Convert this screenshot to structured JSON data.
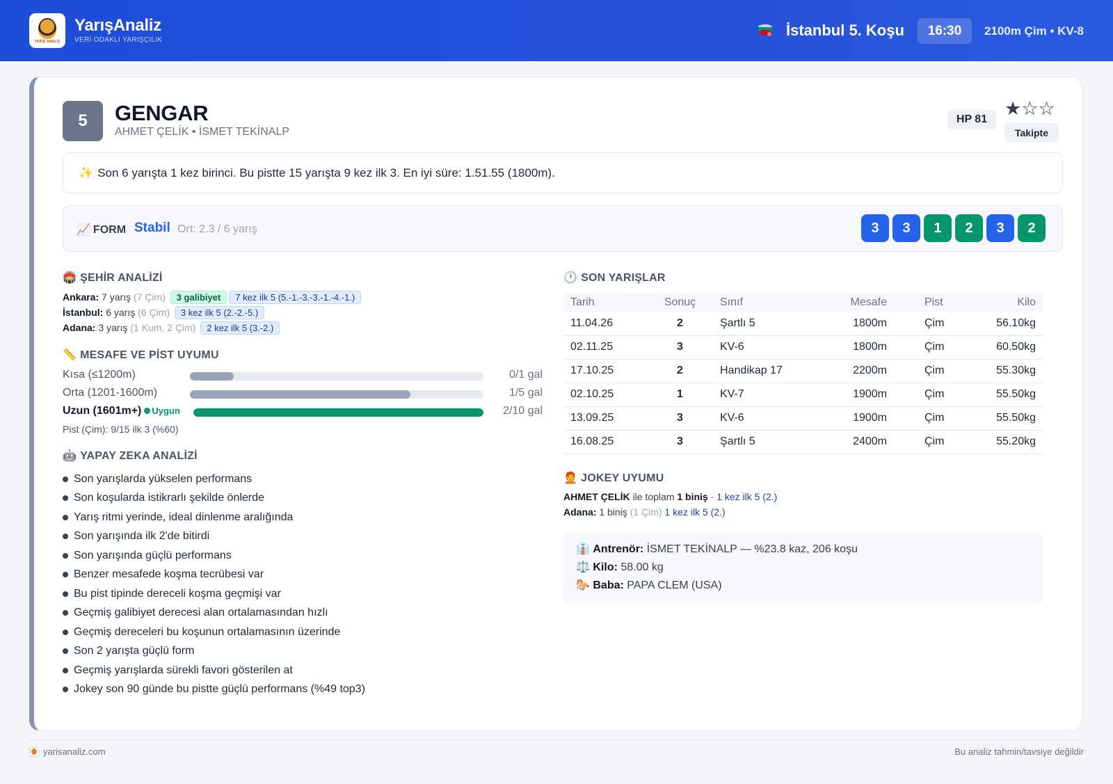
{
  "header": {
    "brand": "YarışAnaliz",
    "tagline": "VERİ ODAKLI YARIŞÇILIK",
    "logo_text": "YARIŞ ANALİZ",
    "race_title": "İstanbul 5. Koşu",
    "time": "16:30",
    "race_meta": "2100m Çim • KV-8"
  },
  "horse": {
    "number": "5",
    "name": "GENGAR",
    "people": "AHMET ÇELİK • İSMET TEKİNALP",
    "hp": "HP 81",
    "stars": "★☆☆",
    "rating": 1,
    "follow_label": "Takipte"
  },
  "summary": {
    "icon": "✨",
    "text": "Son 6 yarışta 1 kez birinci. Bu pistte 15 yarışta 9 kez ilk 3. En iyi süre: 1.51.55 (1800m)."
  },
  "form": {
    "icon": "📈",
    "label": "FORM",
    "status": "Stabil",
    "avg": "Ort: 2.3 / 6 yarış",
    "results": [
      {
        "value": "3",
        "color": "blue"
      },
      {
        "value": "3",
        "color": "blue"
      },
      {
        "value": "1",
        "color": "green"
      },
      {
        "value": "2",
        "color": "green"
      },
      {
        "value": "3",
        "color": "blue"
      },
      {
        "value": "2",
        "color": "green"
      }
    ]
  },
  "city": {
    "icon": "🏟️",
    "title": "ŞEHİR ANALİZİ",
    "rows": [
      {
        "city": "Ankara:",
        "races": " 7 yarış ",
        "detail": "(7 Çim)",
        "win_tag": "3 galibiyet",
        "top_tag": "7 kez ilk 5 (5.-1.-3.-3.-1.-4.-1.)"
      },
      {
        "city": "İstanbul:",
        "races": " 6 yarış ",
        "detail": "(6 Çim)",
        "top_tag": "3 kez ilk 5 (2.-2.-5.)"
      },
      {
        "city": "Adana:",
        "races": " 3 yarış ",
        "detail": "(1 Kum, 2 Çim)",
        "top_tag": "2 kez ilk 5 (3.-2.)"
      }
    ]
  },
  "distance": {
    "icon": "📏",
    "title": "MESAFE VE PİST UYUMU",
    "rows": [
      {
        "label": "Kısa (≤1200m)",
        "value": "0/1 gal",
        "fraction": 0.15,
        "highlight": false
      },
      {
        "label": "Orta (1201-1600m)",
        "value": "1/5 gal",
        "fraction": 0.75,
        "highlight": false
      },
      {
        "label": "Uzun (1601m+)",
        "value": "2/10 gal",
        "fraction": 1.0,
        "highlight": true,
        "badge": "Uygun"
      }
    ],
    "pist": "Pist (Çim): 9/15 ilk 3 (%60)"
  },
  "ai": {
    "icon": "🤖",
    "title": "YAPAY ZEKA ANALİZİ",
    "items": [
      "Son yarışlarda yükselen performans",
      "Son koşularda istikrarlı şekilde önlerde",
      "Yarış ritmi yerinde, ideal dinlenme aralığında",
      "Son yarışında ilk 2'de bitirdi",
      "Son yarışında güçlü performans",
      "Benzer mesafede koşma tecrübesi var",
      "Bu pist tipinde dereceli koşma geçmişi var",
      "Geçmiş galibiyet derecesi alan ortalamasından hızlı",
      "Geçmiş dereceleri bu koşunun ortalamasının üzerinde",
      "Son 2 yarışta güçlü form",
      "Geçmiş yarışlarda sürekli favori gösterilen at",
      "Jokey son 90 günde bu pistte güçlü performans (%49 top3)"
    ]
  },
  "recent": {
    "icon": "🕐",
    "title": "SON YARIŞLAR",
    "headers": [
      "Tarih",
      "Sonuç",
      "Sınıf",
      "Mesafe",
      "Pist",
      "Kilo"
    ],
    "rows": [
      [
        "11.04.26",
        "2",
        "Şartlı 5",
        "1800m",
        "Çim",
        "56.10kg"
      ],
      [
        "02.11.25",
        "3",
        "KV-6",
        "1800m",
        "Çim",
        "60.50kg"
      ],
      [
        "17.10.25",
        "2",
        "Handikap 17",
        "2200m",
        "Çim",
        "55.30kg"
      ],
      [
        "02.10.25",
        "1",
        "KV-7",
        "1900m",
        "Çim",
        "55.50kg"
      ],
      [
        "13.09.25",
        "3",
        "KV-6",
        "1900m",
        "Çim",
        "55.50kg"
      ],
      [
        "16.08.25",
        "3",
        "Şartlı 5",
        "2400m",
        "Çim",
        "55.20kg"
      ]
    ]
  },
  "jockey": {
    "icon": "🧑‍🦰",
    "title": "JOKEY UYUMU",
    "line1_name": "AHMET ÇELİK",
    "line1_mid": " ile toplam ",
    "line1_rides": "1 biniş",
    "line1_sep": " · ",
    "line1_top": "1 kez ilk 5 (2.)",
    "line2_city": "Adana:",
    "line2_rides": " 1 biniş ",
    "line2_detail": "(1 Çim)",
    "line2_top": " 1 kez ilk 5 (2.)"
  },
  "info": {
    "trainer_icon": "👔",
    "trainer_label": "Antrenör:",
    "trainer_value": " İSMET TEKİNALP — %23.8 kaz, 206 koşu",
    "weight_icon": "⚖️",
    "weight_label": "Kilo:",
    "weight_value": " 58.00 kg",
    "sire_icon": "🐎",
    "sire_label": "Baba:",
    "sire_value": " PAPA CLEM (USA)"
  },
  "footer": {
    "site": "yarisanaliz.com",
    "disclaimer": "Bu analiz tahmin/tavsiye değildir"
  },
  "colors": {
    "header_bg": "#1d4ed8",
    "accent_blue": "#2563eb",
    "accent_green": "#059669",
    "result_orange": "#d97706"
  }
}
